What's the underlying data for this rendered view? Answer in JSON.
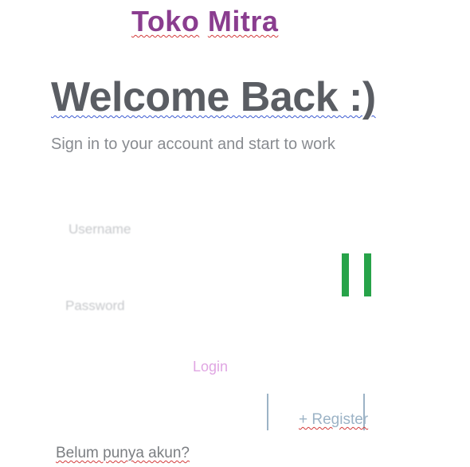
{
  "brand": {
    "word1": "Toko",
    "word2": "Mitra",
    "color": "#8a3d8f"
  },
  "heading": {
    "title": "Welcome Back :)",
    "subtitle": "Sign in to your account and start to work"
  },
  "form": {
    "username_label": "Username",
    "password_label": "Password",
    "login_label": "Login",
    "register_label": "+ Register",
    "no_account_text": "Belum punya akun?"
  },
  "icons": {
    "status": "pause-icon"
  },
  "colors": {
    "heading": "#5a5d63",
    "subtitle": "#888b90",
    "pause": "#27a349",
    "login": "#e0a6e3",
    "register": "#9cb3c6"
  }
}
